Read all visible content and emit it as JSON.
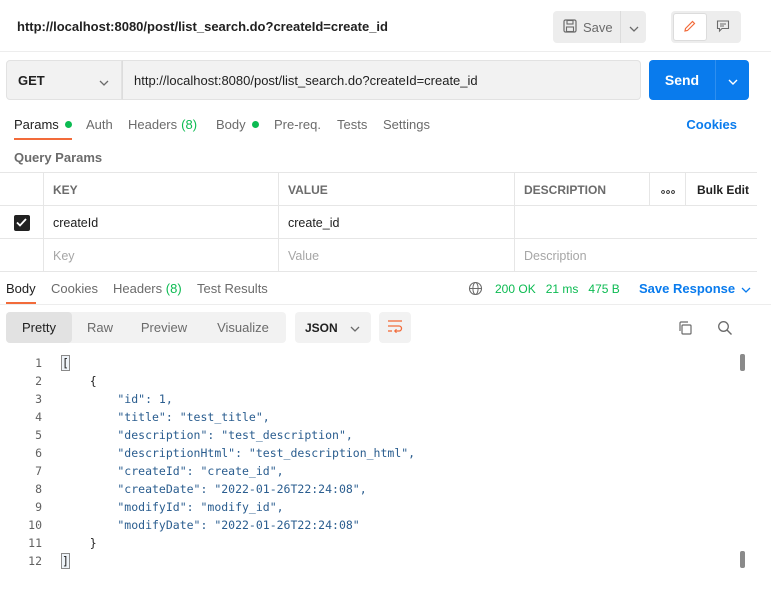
{
  "header": {
    "title": "http://localhost:8080/post/list_search.do?createId=create_id",
    "save_label": "Save"
  },
  "request": {
    "method": "GET",
    "url": "http://localhost:8080/post/list_search.do?createId=create_id",
    "send_label": "Send"
  },
  "request_tabs": {
    "params": "Params",
    "auth": "Auth",
    "headers": "Headers",
    "headers_count": "(8)",
    "body": "Body",
    "prereq": "Pre-req.",
    "tests": "Tests",
    "settings": "Settings",
    "cookies": "Cookies"
  },
  "query_params": {
    "label": "Query Params",
    "columns": {
      "key": "KEY",
      "value": "VALUE",
      "description": "DESCRIPTION",
      "bulk_edit": "Bulk Edit"
    },
    "rows": [
      {
        "key": "createId",
        "value": "create_id",
        "description": "",
        "checked": true
      }
    ],
    "placeholder": {
      "key": "Key",
      "value": "Value",
      "description": "Description"
    }
  },
  "response_tabs": {
    "body": "Body",
    "cookies": "Cookies",
    "headers": "Headers",
    "headers_count": "(8)",
    "test_results": "Test Results"
  },
  "response_status": {
    "status": "200 OK",
    "time": "21 ms",
    "size": "475 B",
    "save_response": "Save Response"
  },
  "view_modes": {
    "pretty": "Pretty",
    "raw": "Raw",
    "preview": "Preview",
    "visualize": "Visualize"
  },
  "format": "JSON",
  "code_lines": [
    {
      "n": "1",
      "text": "["
    },
    {
      "n": "2",
      "text": "    {"
    },
    {
      "n": "3",
      "text": "        \"id\": 1,"
    },
    {
      "n": "4",
      "text": "        \"title\": \"test_title\","
    },
    {
      "n": "5",
      "text": "        \"description\": \"test_description\","
    },
    {
      "n": "6",
      "text": "        \"descriptionHtml\": \"test_description_html\","
    },
    {
      "n": "7",
      "text": "        \"createId\": \"create_id\","
    },
    {
      "n": "8",
      "text": "        \"createDate\": \"2022-01-26T22:24:08\","
    },
    {
      "n": "9",
      "text": "        \"modifyId\": \"modify_id\","
    },
    {
      "n": "10",
      "text": "        \"modifyDate\": \"2022-01-26T22:24:08\""
    },
    {
      "n": "11",
      "text": "    }"
    },
    {
      "n": "12",
      "text": "]"
    }
  ],
  "colors": {
    "accent": "#097bed",
    "tab_underline": "#f26b3a",
    "success": "#0cbb52"
  }
}
